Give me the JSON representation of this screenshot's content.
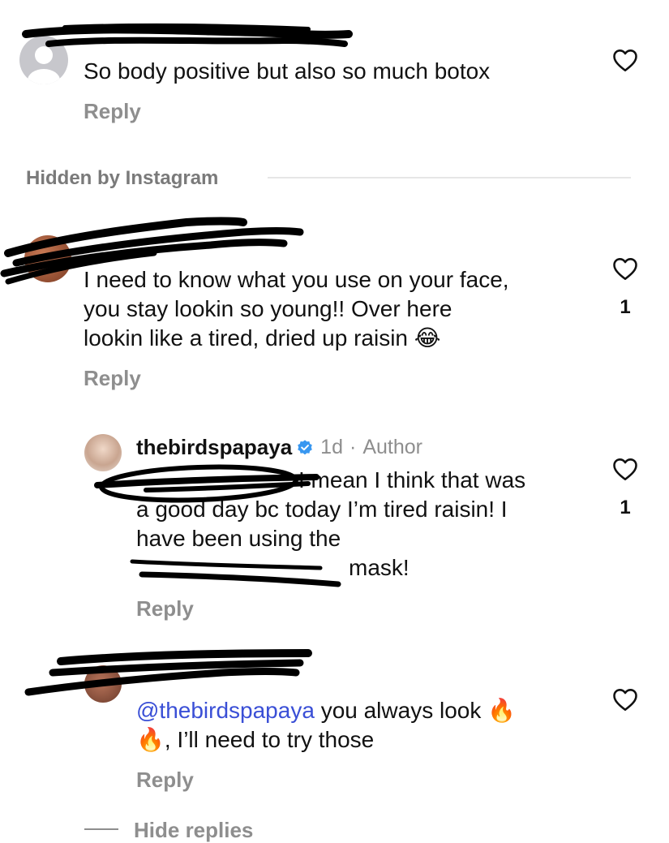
{
  "comments": [
    {
      "text": "So body positive but also so much botox",
      "reply_label": "Reply"
    },
    {
      "text_lines": [
        "I need to know what you use on your face,",
        "you stay lookin so young!! Over here",
        "lookin like a tired, dried up raisin"
      ],
      "emoji": "😂",
      "like_count": "1",
      "reply_label": "Reply"
    },
    {
      "username": "thebirdspapaya",
      "time": "1d",
      "separator": "·",
      "author_tag": "Author",
      "line1_rest": "I mean I think that was",
      "line2": "a good day bc today I’m tired raisin! I",
      "line3": "have been using the",
      "line4_rest": "mask!",
      "like_count": "1",
      "reply_label": "Reply"
    },
    {
      "mention": "@thebirdspapaya",
      "text_rest": "you always look",
      "emoji1": "🔥",
      "emoji2": "🔥",
      "line2_rest": ", I’ll need to try those",
      "reply_label": "Reply"
    }
  ],
  "hidden_section": {
    "label": "Hidden by Instagram"
  },
  "hide_replies": {
    "label": "Hide replies"
  },
  "colors": {
    "mention": "#3a4fd6",
    "secondary": "#8e8e8e",
    "verified": "#3897f0"
  },
  "icons": [
    "heart-icon",
    "verified-icon",
    "avatar"
  ]
}
